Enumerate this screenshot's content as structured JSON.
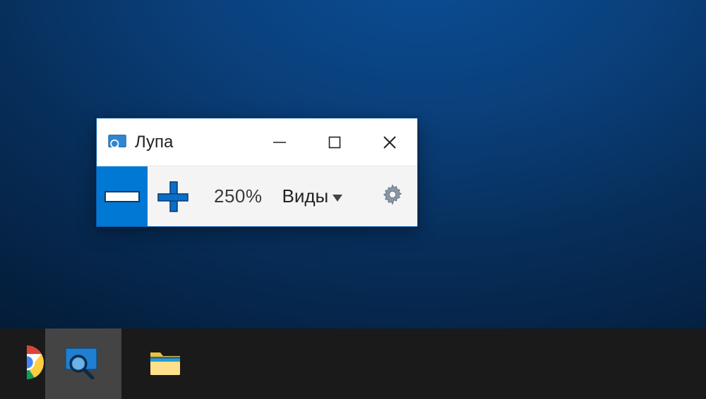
{
  "window": {
    "title": "Лупа",
    "minimize_label": "Minimize",
    "maximize_label": "Maximize",
    "close_label": "Close"
  },
  "toolbar": {
    "zoom_out_label": "Zoom out",
    "zoom_in_label": "Zoom in",
    "zoom_level": "250%",
    "views_label": "Виды",
    "settings_label": "Settings"
  },
  "taskbar": {
    "items": [
      {
        "name": "chrome",
        "label": "Google Chrome"
      },
      {
        "name": "magnifier",
        "label": "Лупа",
        "active": true
      },
      {
        "name": "file-explorer",
        "label": "File Explorer"
      }
    ]
  },
  "colors": {
    "accent": "#0078d4"
  }
}
